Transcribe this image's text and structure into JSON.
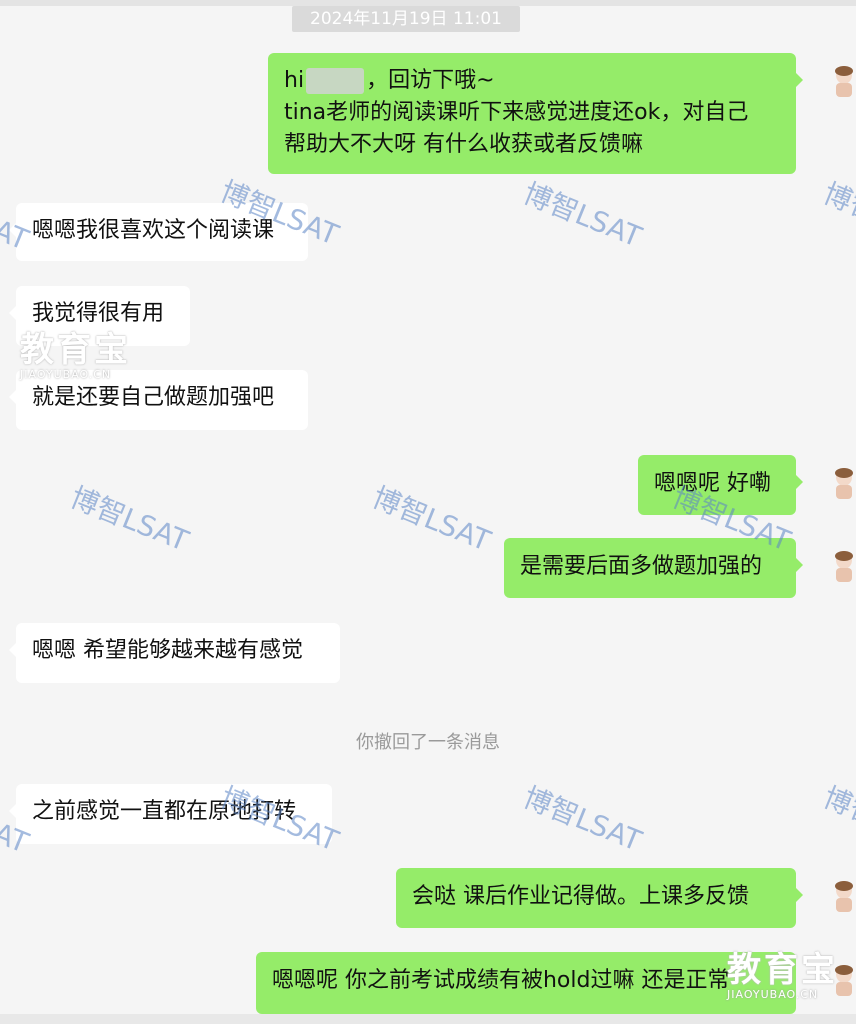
{
  "timestamp": "2024年11月19日 11:01",
  "watermark_text": "博智LSAT",
  "logo": {
    "name": "教育宝",
    "domain": "JIAOYUBAO.CN"
  },
  "system_notice": "你撤回了一条消息",
  "messages": [
    {
      "side": "out",
      "lines": [
        "hi",
        "，回访下哦~",
        "tina老师的阅读课听下来感觉进度还ok，对自己",
        "帮助大不大呀  有什么收获或者反馈嘛"
      ]
    },
    {
      "side": "in",
      "text": "嗯嗯我很喜欢这个阅读课"
    },
    {
      "side": "in",
      "text": "我觉得很有用"
    },
    {
      "side": "in",
      "text": "就是还要自己做题加强吧"
    },
    {
      "side": "out",
      "text": "嗯嗯呢 好嘞"
    },
    {
      "side": "out",
      "text": "是需要后面多做题加强的"
    },
    {
      "side": "in",
      "text": "嗯嗯 希望能够越来越有感觉"
    },
    {
      "side": "in",
      "text": "之前感觉一直都在原地打转"
    },
    {
      "side": "out",
      "text": "会哒  课后作业记得做。上课多反馈"
    },
    {
      "side": "out",
      "text": "嗯嗯呢  你之前考试成绩有被hold过嘛  还是正常"
    }
  ],
  "colors": {
    "outgoing": "#95ec69",
    "incoming": "#ffffff",
    "background": "#f5f5f5",
    "watermark": "#5b85c6"
  }
}
